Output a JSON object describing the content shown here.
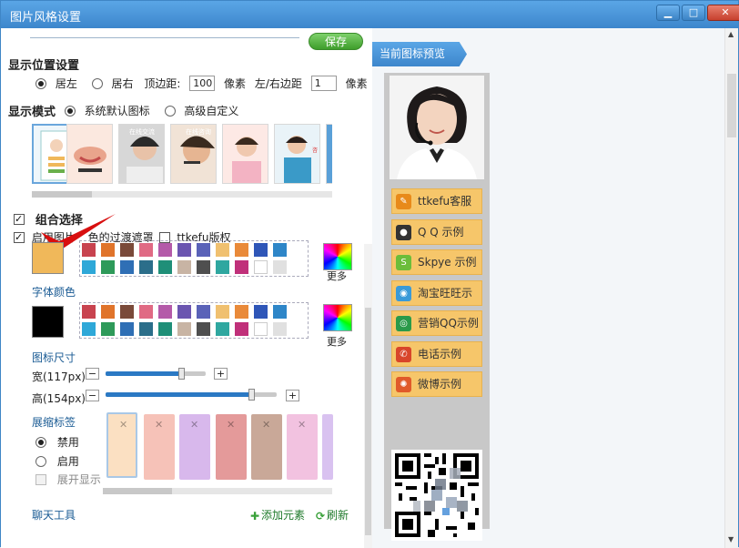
{
  "window": {
    "title": "图片风格设置",
    "controls": {
      "minimize": "▁",
      "maximize": "□",
      "close": "✕"
    }
  },
  "left": {
    "save_label": "保存",
    "position": {
      "title": "显示位置设置",
      "left_label": "居左",
      "right_label": "居右",
      "top_margin_label": "顶边距:",
      "top_margin_value": "100",
      "unit1": "像素",
      "side_margin_label": "左/右边距",
      "side_margin_value": "1",
      "unit2": "像素",
      "selected": "left"
    },
    "mode": {
      "title": "显示模式",
      "default_label": "系统默认图标",
      "custom_label": "高级自定义",
      "selected": "default"
    },
    "combo": {
      "label": "组合选择",
      "enable_label": "启用图片",
      "overlay_label": "色的过渡遮罩",
      "copyright_label": "ttkefu版权"
    },
    "more_label": "更多",
    "font_color_label": "字体颜色",
    "size": {
      "title": "图标尺寸",
      "width_label": "宽(117px)",
      "height_label": "高(154px)",
      "width_level": 0.75,
      "height_level": 0.85
    },
    "tab": {
      "title": "展缩标签",
      "disable_label": "禁用",
      "enable_label": "启用",
      "expand_label": "展开显示"
    },
    "chat_tools_label": "聊天工具",
    "add_element_label": "添加元素",
    "refresh_label": "刷新"
  },
  "palette_colors": [
    "#c8434f",
    "#e0742b",
    "#7a4a3a",
    "#e06a84",
    "#b45aa9",
    "#6b55b0",
    "#5a62b8",
    "#f0c070",
    "#e98a3a",
    "#2f56b8",
    "#2e86c8",
    "#2ea8d8",
    "#2e9a5a",
    "#2f6fb5",
    "#2b6e8a",
    "#1f8f78",
    "#c8b4a4",
    "#4f4f4f",
    "#2fa7a0",
    "#c0307a",
    "#ffffff",
    "#e0e0e0"
  ],
  "colors": {
    "icon_color": "#f0b85a",
    "font_color": "#000000",
    "accent": "#3d86cc",
    "button_fill": "#f6c66a"
  },
  "right": {
    "preview_title": "当前图标预览",
    "buttons": [
      {
        "label": "ttkefu客服",
        "icon": "chat-bubble-icon",
        "color": "#e88a1a"
      },
      {
        "label": "Q Q 示例",
        "icon": "qq-penguin-icon",
        "color": "#333333"
      },
      {
        "label": "Skpye 示例",
        "icon": "skype-icon",
        "color": "#6cbd3a"
      },
      {
        "label": "淘宝旺旺示",
        "icon": "wangwang-icon",
        "color": "#3a9ad8"
      },
      {
        "label": "营销QQ示例",
        "icon": "marketing-qq-icon",
        "color": "#2a9a4a"
      },
      {
        "label": "电话示例",
        "icon": "phone-icon",
        "color": "#d8452a"
      },
      {
        "label": "微博示例",
        "icon": "weibo-icon",
        "color": "#e05a2a"
      }
    ]
  }
}
